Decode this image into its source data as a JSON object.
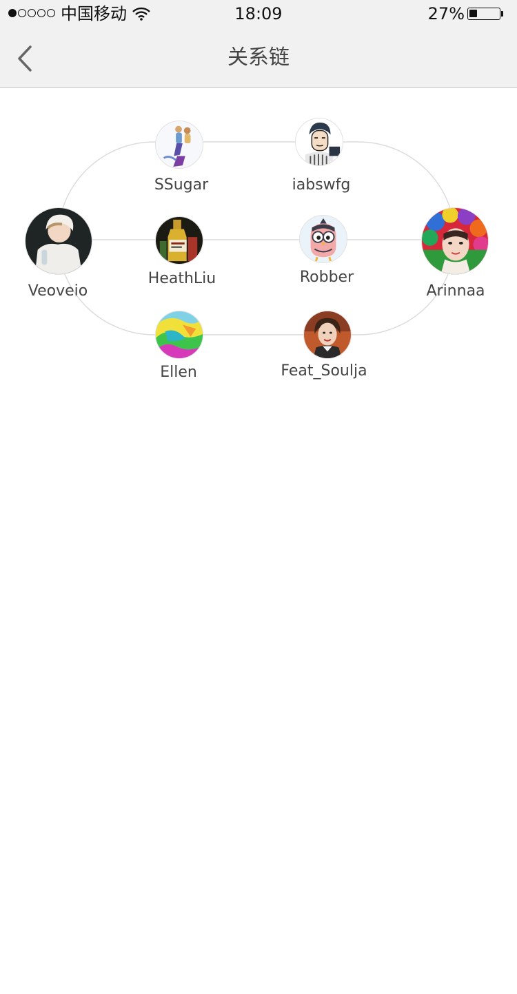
{
  "status_bar": {
    "carrier": "中国移动",
    "time": "18:09",
    "battery_percent": "27%",
    "battery_level": 0.27,
    "signal_strength": 1,
    "icons": [
      "signal-dots-icon",
      "wifi-icon",
      "battery-icon"
    ]
  },
  "nav": {
    "title": "关系链",
    "back_icon": "chevron-left-icon"
  },
  "colors": {
    "bar_background": "#f1f1f1",
    "text": "#444444",
    "connector": "#dddddd"
  },
  "users": [
    {
      "name": "SSugar"
    },
    {
      "name": "iabswfg"
    },
    {
      "name": "Veoveio"
    },
    {
      "name": "HeathLiu"
    },
    {
      "name": "Robber"
    },
    {
      "name": "Arinnaa"
    },
    {
      "name": "Ellen"
    },
    {
      "name": "Feat_Soulja"
    }
  ]
}
